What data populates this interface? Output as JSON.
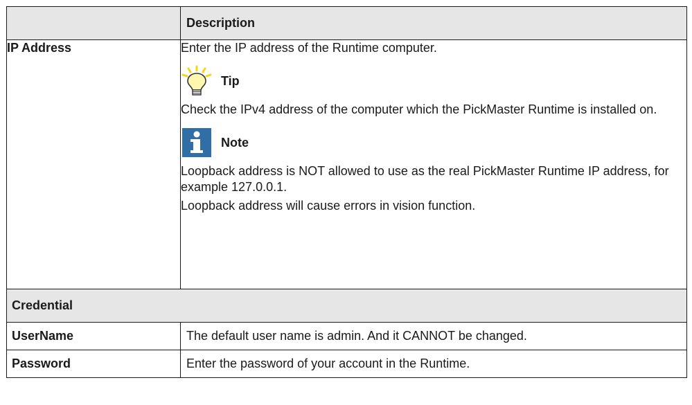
{
  "table": {
    "header": {
      "col1": "",
      "col2": "Description"
    },
    "ip_row": {
      "label": "IP Address",
      "intro": "Enter the IP address of the Runtime computer.",
      "tip": {
        "icon": "lightbulb-icon",
        "label": "Tip",
        "text": "Check the IPv4 address of the computer which the PickMaster Runtime is installed on."
      },
      "note": {
        "icon": "info-icon",
        "label": "Note",
        "text1": "Loopback address is NOT allowed to use as the real PickMaster Runtime IP address, for example 127.0.0.1.",
        "text2": "Loopback address will cause errors in vision function."
      }
    },
    "section": {
      "label": "Credential"
    },
    "rows": [
      {
        "label": "UserName",
        "text": "The default user name is admin. And it CANNOT be changed."
      },
      {
        "label": "Password",
        "text": "Enter the password of your account in the Runtime."
      }
    ]
  },
  "colors": {
    "header_bg": "#e6e6e6",
    "border": "#1a1a1a",
    "tip_yellow": "#f6d60f",
    "note_blue": "#2f6ea7"
  }
}
